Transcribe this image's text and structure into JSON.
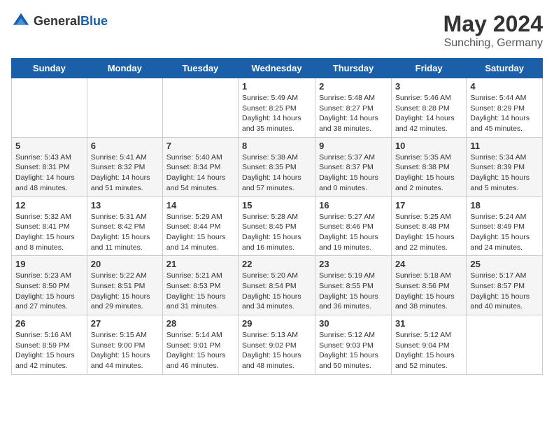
{
  "header": {
    "logo_general": "General",
    "logo_blue": "Blue",
    "month_year": "May 2024",
    "location": "Sunching, Germany"
  },
  "weekdays": [
    "Sunday",
    "Monday",
    "Tuesday",
    "Wednesday",
    "Thursday",
    "Friday",
    "Saturday"
  ],
  "weeks": [
    [
      {
        "day": "",
        "info": ""
      },
      {
        "day": "",
        "info": ""
      },
      {
        "day": "",
        "info": ""
      },
      {
        "day": "1",
        "info": "Sunrise: 5:49 AM\nSunset: 8:25 PM\nDaylight: 14 hours\nand 35 minutes."
      },
      {
        "day": "2",
        "info": "Sunrise: 5:48 AM\nSunset: 8:27 PM\nDaylight: 14 hours\nand 38 minutes."
      },
      {
        "day": "3",
        "info": "Sunrise: 5:46 AM\nSunset: 8:28 PM\nDaylight: 14 hours\nand 42 minutes."
      },
      {
        "day": "4",
        "info": "Sunrise: 5:44 AM\nSunset: 8:29 PM\nDaylight: 14 hours\nand 45 minutes."
      }
    ],
    [
      {
        "day": "5",
        "info": "Sunrise: 5:43 AM\nSunset: 8:31 PM\nDaylight: 14 hours\nand 48 minutes."
      },
      {
        "day": "6",
        "info": "Sunrise: 5:41 AM\nSunset: 8:32 PM\nDaylight: 14 hours\nand 51 minutes."
      },
      {
        "day": "7",
        "info": "Sunrise: 5:40 AM\nSunset: 8:34 PM\nDaylight: 14 hours\nand 54 minutes."
      },
      {
        "day": "8",
        "info": "Sunrise: 5:38 AM\nSunset: 8:35 PM\nDaylight: 14 hours\nand 57 minutes."
      },
      {
        "day": "9",
        "info": "Sunrise: 5:37 AM\nSunset: 8:37 PM\nDaylight: 15 hours\nand 0 minutes."
      },
      {
        "day": "10",
        "info": "Sunrise: 5:35 AM\nSunset: 8:38 PM\nDaylight: 15 hours\nand 2 minutes."
      },
      {
        "day": "11",
        "info": "Sunrise: 5:34 AM\nSunset: 8:39 PM\nDaylight: 15 hours\nand 5 minutes."
      }
    ],
    [
      {
        "day": "12",
        "info": "Sunrise: 5:32 AM\nSunset: 8:41 PM\nDaylight: 15 hours\nand 8 minutes."
      },
      {
        "day": "13",
        "info": "Sunrise: 5:31 AM\nSunset: 8:42 PM\nDaylight: 15 hours\nand 11 minutes."
      },
      {
        "day": "14",
        "info": "Sunrise: 5:29 AM\nSunset: 8:44 PM\nDaylight: 15 hours\nand 14 minutes."
      },
      {
        "day": "15",
        "info": "Sunrise: 5:28 AM\nSunset: 8:45 PM\nDaylight: 15 hours\nand 16 minutes."
      },
      {
        "day": "16",
        "info": "Sunrise: 5:27 AM\nSunset: 8:46 PM\nDaylight: 15 hours\nand 19 minutes."
      },
      {
        "day": "17",
        "info": "Sunrise: 5:25 AM\nSunset: 8:48 PM\nDaylight: 15 hours\nand 22 minutes."
      },
      {
        "day": "18",
        "info": "Sunrise: 5:24 AM\nSunset: 8:49 PM\nDaylight: 15 hours\nand 24 minutes."
      }
    ],
    [
      {
        "day": "19",
        "info": "Sunrise: 5:23 AM\nSunset: 8:50 PM\nDaylight: 15 hours\nand 27 minutes."
      },
      {
        "day": "20",
        "info": "Sunrise: 5:22 AM\nSunset: 8:51 PM\nDaylight: 15 hours\nand 29 minutes."
      },
      {
        "day": "21",
        "info": "Sunrise: 5:21 AM\nSunset: 8:53 PM\nDaylight: 15 hours\nand 31 minutes."
      },
      {
        "day": "22",
        "info": "Sunrise: 5:20 AM\nSunset: 8:54 PM\nDaylight: 15 hours\nand 34 minutes."
      },
      {
        "day": "23",
        "info": "Sunrise: 5:19 AM\nSunset: 8:55 PM\nDaylight: 15 hours\nand 36 minutes."
      },
      {
        "day": "24",
        "info": "Sunrise: 5:18 AM\nSunset: 8:56 PM\nDaylight: 15 hours\nand 38 minutes."
      },
      {
        "day": "25",
        "info": "Sunrise: 5:17 AM\nSunset: 8:57 PM\nDaylight: 15 hours\nand 40 minutes."
      }
    ],
    [
      {
        "day": "26",
        "info": "Sunrise: 5:16 AM\nSunset: 8:59 PM\nDaylight: 15 hours\nand 42 minutes."
      },
      {
        "day": "27",
        "info": "Sunrise: 5:15 AM\nSunset: 9:00 PM\nDaylight: 15 hours\nand 44 minutes."
      },
      {
        "day": "28",
        "info": "Sunrise: 5:14 AM\nSunset: 9:01 PM\nDaylight: 15 hours\nand 46 minutes."
      },
      {
        "day": "29",
        "info": "Sunrise: 5:13 AM\nSunset: 9:02 PM\nDaylight: 15 hours\nand 48 minutes."
      },
      {
        "day": "30",
        "info": "Sunrise: 5:12 AM\nSunset: 9:03 PM\nDaylight: 15 hours\nand 50 minutes."
      },
      {
        "day": "31",
        "info": "Sunrise: 5:12 AM\nSunset: 9:04 PM\nDaylight: 15 hours\nand 52 minutes."
      },
      {
        "day": "",
        "info": ""
      }
    ]
  ]
}
